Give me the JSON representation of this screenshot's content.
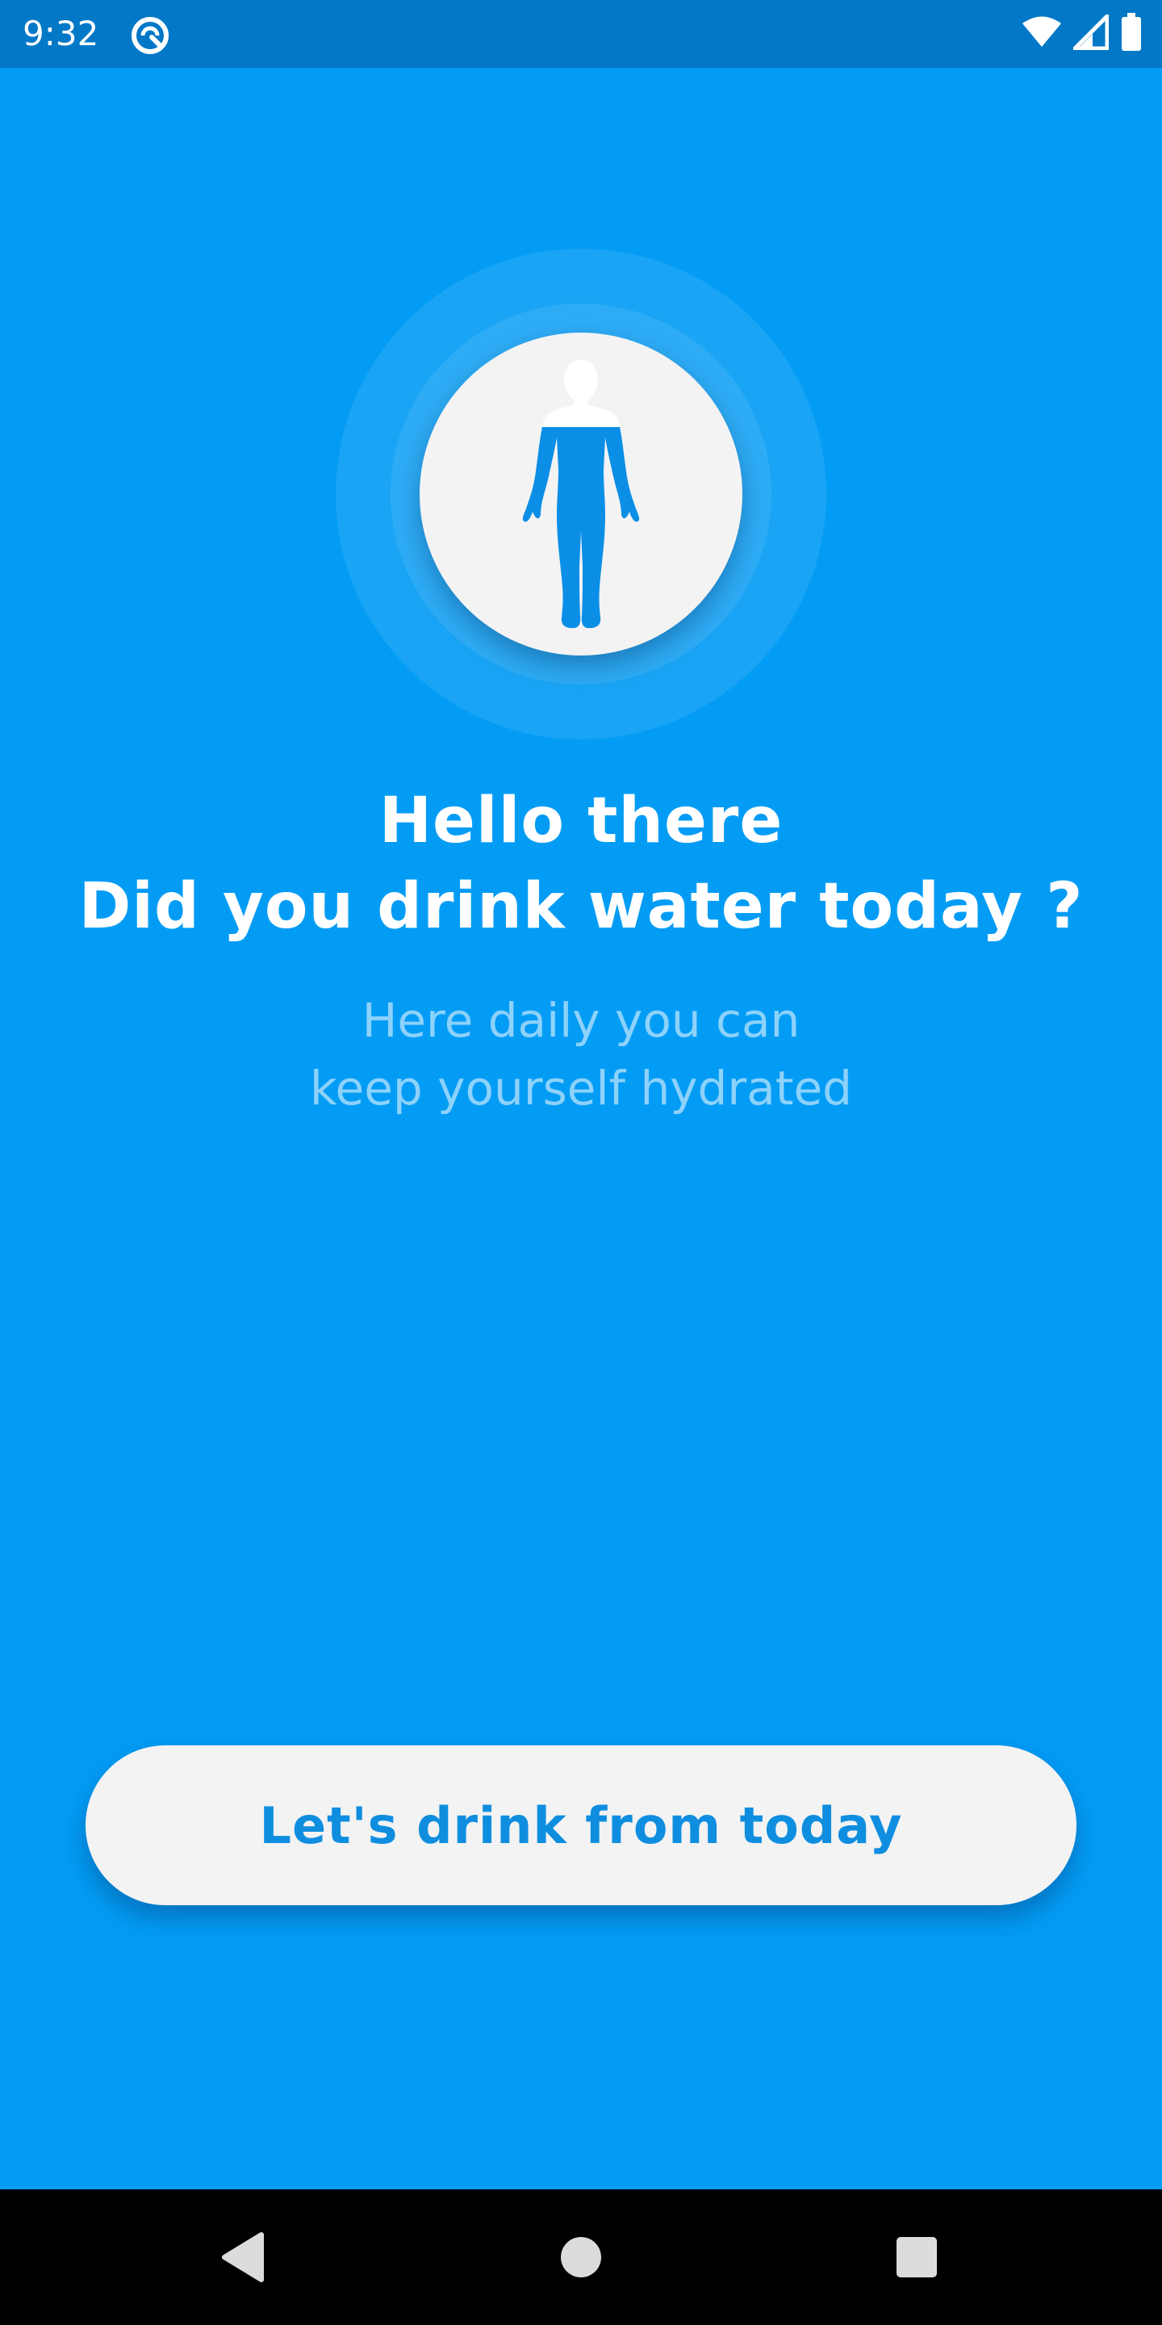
{
  "status_bar": {
    "time": "9:32",
    "icons": [
      "app-notification-icon",
      "wifi-icon",
      "cellular-signal-icon",
      "battery-icon"
    ]
  },
  "hero": {
    "icon": "human-body-icon",
    "water_fill_fraction": 0.75
  },
  "title": {
    "line1": "Hello there",
    "line2": "Did you drink water today ?"
  },
  "subtitle": {
    "line1": "Here daily you can",
    "line2": "keep yourself hydrated"
  },
  "cta": {
    "label": "Let's drink from today"
  },
  "nav_bar": {
    "buttons": [
      "back-icon",
      "home-icon",
      "recents-icon"
    ]
  },
  "colors": {
    "background": "#039cf5",
    "status_bar": "#0278c7",
    "accent": "#0f8ee0",
    "button_bg": "#f3f3f3"
  }
}
